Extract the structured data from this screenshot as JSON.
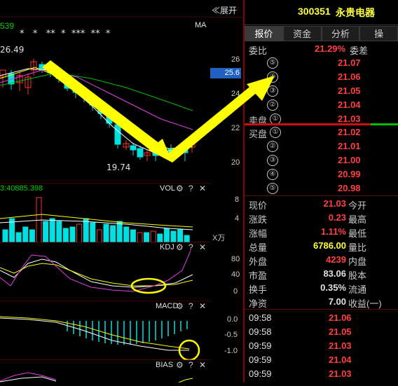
{
  "topbar": {
    "expand_label": "≪展开",
    "ma_label": "MA",
    "number_fragment": "539"
  },
  "stock": {
    "code": "300351",
    "name": "永贵电器"
  },
  "tabs": [
    "报价",
    "资金",
    "分析",
    "操"
  ],
  "quote": {
    "weibi_label": "委比",
    "weibi_value": "21.29%",
    "weicha_label": "委差",
    "sell_label": "卖盘",
    "buy_label": "买盘",
    "asks": [
      "21.07",
      "21.06",
      "21.05",
      "21.04",
      "21.03"
    ],
    "bids": [
      "21.02",
      "21.01",
      "21.00",
      "20.99",
      "20.98"
    ],
    "ask_nums": [
      "⑤",
      "④",
      "③",
      "②",
      "①"
    ],
    "bid_nums": [
      "①",
      "②",
      "③",
      "④",
      "⑤"
    ]
  },
  "stats": {
    "r1": {
      "l1": "现价",
      "v1": "21.03",
      "l2": "今开"
    },
    "r2": {
      "l1": "涨跌",
      "v1": "0.23",
      "l2": "最高"
    },
    "r3": {
      "l1": "涨幅",
      "v1": "1.11%",
      "l2": "最低"
    },
    "r4": {
      "l1": "总量",
      "v1": "6786.00",
      "l2": "量比"
    },
    "r5": {
      "l1": "外盘",
      "v1": "4239",
      "l2": "内盘"
    },
    "r6": {
      "l1": "市盈",
      "v1": "83.06",
      "l2": "股本"
    },
    "r7": {
      "l1": "换手",
      "v1": "0.35%",
      "l2": "流通"
    },
    "r8": {
      "l1": "净资",
      "v1": "7.00",
      "l2": "收益(一)"
    }
  },
  "ticks": [
    {
      "time": "09:58",
      "price": "21.06"
    },
    {
      "time": "09:58",
      "price": "21.05"
    },
    {
      "time": "09:59",
      "price": "21.03"
    },
    {
      "time": "09:59",
      "price": "21.04"
    },
    {
      "time": "09:59",
      "price": "21.03"
    }
  ],
  "price_chart": {
    "high_label": "26.49",
    "low_label": "19.74",
    "current_price_tag": "25.6",
    "y_ticks": [
      "26",
      "24",
      "22",
      "20"
    ],
    "stars": "*   *   **  *  ***  **  *"
  },
  "vol_panel": {
    "title": "VOL",
    "info": "3:40885.398",
    "y_ticks": [
      "8",
      "4"
    ],
    "unit": "X万"
  },
  "kdj_panel": {
    "title": "KDJ",
    "y_ticks": [
      "80",
      "40",
      "0"
    ]
  },
  "macd_panel": {
    "title": "MACD",
    "y_ticks": [
      "0.0",
      "-0.5",
      "-1.0"
    ]
  },
  "bias_panel": {
    "title": "BIAS"
  },
  "colors": {
    "up": "#ff3030",
    "down": "#00e0e0",
    "arrow": "#ffff00",
    "divider": "#8a0000"
  }
}
